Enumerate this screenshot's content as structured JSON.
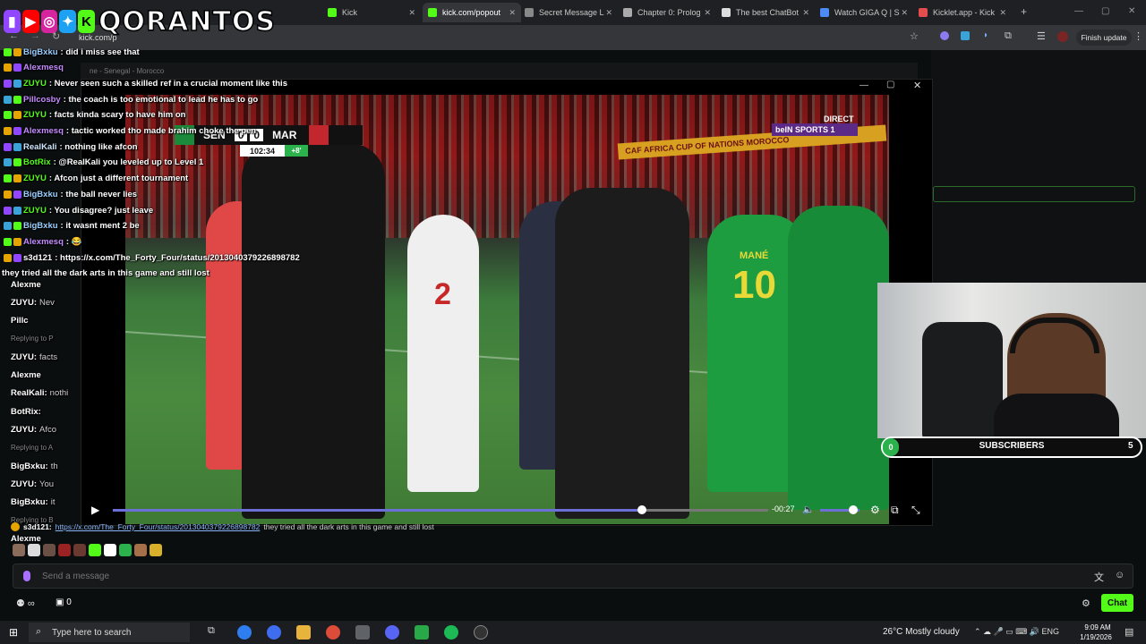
{
  "browser": {
    "tabs": [
      {
        "label": "",
        "color": "#53fc18"
      },
      {
        "label": "Kick",
        "color": "#53fc18"
      },
      {
        "label": "kick.com/popout",
        "color": "#53fc18",
        "active": true
      },
      {
        "label": "Secret Message L",
        "color": "#888888"
      },
      {
        "label": "Chapter 0: Prolog",
        "color": "#aaaaaa"
      },
      {
        "label": "The best ChatBot",
        "color": "#dddddd"
      },
      {
        "label": "Watch GIGA Q | S",
        "color": "#4c8bf5"
      },
      {
        "label": "Kicklet.app - Kick",
        "color": "#e34d4d"
      }
    ],
    "url": "kick.com/p",
    "finish_update": "Finish update"
  },
  "logo": {
    "text": "QORANTOS"
  },
  "chat": {
    "messages": [
      {
        "user": "BigBxku",
        "text": ": did i miss see that",
        "color": "#9ad0ff"
      },
      {
        "user": "Alexmesq",
        "text": "",
        "color": "#c58bff"
      },
      {
        "user": "ZUYU",
        "text": ": Never seen such a skilled ref in a crucial moment like this",
        "color": "#53fc18"
      },
      {
        "user": "Pillcosby",
        "text": ": the coach is too emotional to lead he has to go",
        "color": "#c58bff"
      },
      {
        "user": "ZUYU",
        "text": ": facts kinda scary to have him on",
        "color": "#53fc18"
      },
      {
        "user": "Alexmesq",
        "text": ": tactic worked tho made brahim choke the pen",
        "color": "#c58bff"
      },
      {
        "user": "RealKali",
        "text": ": nothing like afcon",
        "color": "#cfe8ff"
      },
      {
        "user": "BotRix",
        "text": ": @RealKali you leveled up to Level 1",
        "color": "#53fc18"
      },
      {
        "user": "ZUYU",
        "text": ": Afcon just a different tournament",
        "color": "#53fc18"
      },
      {
        "user": "BigBxku",
        "text": ": the ball never lies",
        "color": "#9ad0ff"
      },
      {
        "user": "ZUYU",
        "text": ": You disagree? just leave",
        "color": "#53fc18"
      },
      {
        "user": "BigBxku",
        "text": ": it wasnt ment 2 be",
        "color": "#9ad0ff"
      },
      {
        "user": "Alexmesq",
        "text": ": 😂",
        "color": "#c58bff"
      },
      {
        "user": "s3d121",
        "text": ": https://x.com/The_Forty_Four/status/2013040379226898782",
        "color": "#ffffff"
      },
      {
        "user": "",
        "text": "they tried all the dark arts in this game and still lost",
        "color": "#ffffff"
      }
    ],
    "lower": [
      {
        "user": "Alexme",
        "text": ""
      },
      {
        "user": "ZUYU:",
        "text": "Nev"
      },
      {
        "user": "Pillc",
        "text": ""
      },
      {
        "user": "",
        "text": "Replying to P"
      },
      {
        "user": "ZUYU:",
        "text": "facts"
      },
      {
        "user": "Alexme",
        "text": ""
      },
      {
        "user": "RealKali:",
        "text": "nothi"
      },
      {
        "user": "BotRix:",
        "text": ""
      },
      {
        "user": "ZUYU:",
        "text": "Afco"
      },
      {
        "user": "",
        "text": "Replying to A"
      },
      {
        "user": "BigBxku:",
        "text": "th"
      },
      {
        "user": "ZUYU:",
        "text": "You"
      },
      {
        "user": "BigBxku:",
        "text": "it"
      },
      {
        "user": "",
        "text": "Replying to B"
      },
      {
        "user": "Alexme",
        "text": ""
      }
    ],
    "pinned": {
      "user": "s3d121:",
      "link": "https://x.com/The_Forty_Four/status/2013040379226898782",
      "text": "they tried all the dark arts in this game and still lost"
    },
    "input_placeholder": "Send a message",
    "points": "0",
    "chat_button": "Chat"
  },
  "video": {
    "back_title": "ne - Senegal - Morocco",
    "score": {
      "home": "SEN",
      "home_score": "0",
      "away_score": "0",
      "away": "MAR",
      "clock": "102:34",
      "added": "+8'"
    },
    "broadcaster": {
      "direct": "DIRECT",
      "name": "beIN SPORTS 1"
    },
    "banner": "CAF AFRICA CUP OF NATIONS MOROCCO",
    "jersey_name": "MANÉ",
    "jersey_number": "10",
    "time_remaining": "-00:27",
    "progress": 0.807,
    "volume": 0.85
  },
  "overlay": {
    "subscribers_label": "SUBSCRIBERS",
    "sub_current": "0",
    "sub_goal": "5"
  },
  "taskbar": {
    "search_placeholder": "Type here to search",
    "weather": "26°C  Mostly cloudy",
    "lang": "ENG",
    "time": "9:09 AM",
    "date": "1/19/2026"
  },
  "colors": {
    "kick_green": "#53fc18",
    "progress": "#6b6fd6"
  }
}
